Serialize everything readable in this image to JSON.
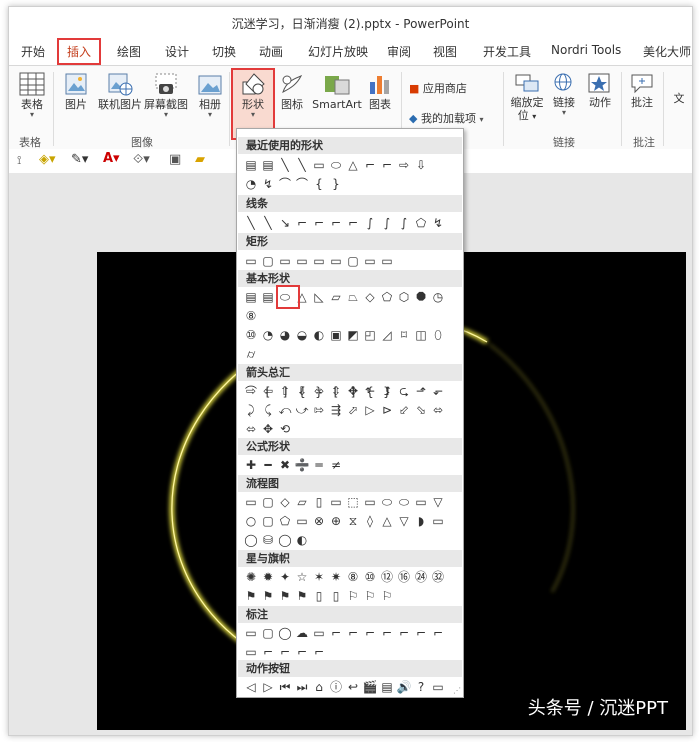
{
  "window": {
    "title": "沉迷学习，日渐消瘦 (2).pptx - PowerPoint"
  },
  "tabs": [
    {
      "label": "开始"
    },
    {
      "label": "插入",
      "active": true
    },
    {
      "label": "绘图"
    },
    {
      "label": "设计"
    },
    {
      "label": "切换"
    },
    {
      "label": "动画"
    },
    {
      "label": "幻灯片放映"
    },
    {
      "label": "审阅"
    },
    {
      "label": "视图"
    },
    {
      "label": "开发工具"
    },
    {
      "label": "Nordri Tools"
    },
    {
      "label": "美化大师"
    }
  ],
  "ribbon": {
    "table": "表格",
    "picture": "图片",
    "online_picture": "联机图片",
    "screenshot": "屏幕截图",
    "album": "相册",
    "shapes": "形状",
    "icons": "图标",
    "smartart": "SmartArt",
    "chart": "图表",
    "store": "应用商店",
    "my_addins": "我的加载项",
    "zoom_line1": "缩放定",
    "zoom_line2": "位",
    "link": "链接",
    "action": "动作",
    "comment": "批注",
    "text_partial": "文",
    "groups": {
      "table": "表格",
      "images": "图像",
      "links": "链接",
      "comments": "批注"
    }
  },
  "shapes_menu": {
    "sections": {
      "recent": "最近使用的形状",
      "lines": "线条",
      "rect": "矩形",
      "basic": "基本形状",
      "arrows": "箭头总汇",
      "equation": "公式形状",
      "flowchart": "流程图",
      "stars": "星与旗帜",
      "callouts": "标注",
      "action": "动作按钮"
    },
    "recent_row1": [
      "▤",
      "▤",
      "╲",
      "╲",
      "▭",
      "⬭",
      "△",
      "⌐",
      "⌐",
      "⇨",
      "⇩"
    ],
    "recent_row2": [
      "◔",
      "↯",
      "⌒",
      "⌒",
      "{",
      "}"
    ],
    "lines_row": [
      "╲",
      "╲",
      "↘",
      "⌐",
      "⌐",
      "⌐",
      "⌐",
      "∫",
      "∫",
      "∫",
      "⬠",
      "↯"
    ],
    "rect_row": [
      "▭",
      "▢",
      "▭",
      "▭",
      "▭",
      "▭",
      "▢",
      "▭",
      "▭"
    ],
    "basic_row1": [
      "▤",
      "▤",
      "⬭",
      "△",
      "◺",
      "▱",
      "⏢",
      "◇",
      "⬠",
      "⬡",
      "⯃",
      "◷",
      "⑧"
    ],
    "basic_row2": [
      "⑩",
      "◔",
      "◕",
      "◒",
      "◐",
      "▣",
      "◩",
      "◰",
      "◿",
      "⌑",
      "◫",
      "⬯",
      "⌭"
    ],
    "basic_row3": [
      "⬚",
      "▣",
      "◎",
      "⊘",
      "◠",
      "⎔",
      "☺",
      "♡",
      "⚡",
      "☼",
      "☾",
      "☁"
    ],
    "basic_row4": [
      "⌒",
      "[",
      "]",
      "{",
      "}",
      "[",
      "]",
      "{",
      "}"
    ],
    "arrows_row1": [
      "⇨",
      "⇦",
      "⇧",
      "⇩",
      "⬄",
      "⇳",
      "✥",
      "⬑",
      "⮥",
      "⮎",
      "⬏",
      "⬐"
    ],
    "arrows_row2": [
      "⤸",
      "⤹",
      "⤺",
      "⤻",
      "⇰",
      "⇶",
      "⬀",
      "▷",
      "⊳",
      "⬃",
      "⬂",
      "⬄"
    ],
    "arrows_row3": [
      "⬄",
      "✥",
      "⟲"
    ],
    "equation_row": [
      "✚",
      "━",
      "✖",
      "➗",
      "═",
      "≠"
    ],
    "flow_row1": [
      "▭",
      "▢",
      "◇",
      "▱",
      "▯",
      "▭",
      "⬚",
      "▭",
      "⬭",
      "⬭",
      "▭",
      "▽"
    ],
    "flow_row2": [
      "○",
      "▢",
      "⬠",
      "▭",
      "⊗",
      "⊕",
      "⧖",
      "◊",
      "△",
      "▽",
      "◗",
      "▭"
    ],
    "flow_row3": [
      "◯",
      "⛁",
      "◯",
      "◐"
    ],
    "stars_row1": [
      "✺",
      "✹",
      "✦",
      "☆",
      "✶",
      "✷",
      "⑧",
      "⑩",
      "⑫",
      "⑯",
      "㉔",
      "㉜"
    ],
    "stars_row2": [
      "⚑",
      "⚑",
      "⚑",
      "⚑",
      "▯",
      "▯",
      "⚐",
      "⚐",
      "⚐"
    ],
    "callouts_row1": [
      "▭",
      "▢",
      "◯",
      "☁",
      "▭",
      "⌐",
      "⌐",
      "⌐",
      "⌐",
      "⌐",
      "⌐",
      "⌐"
    ],
    "callouts_row2": [
      "▭",
      "⌐",
      "⌐",
      "⌐",
      "⌐"
    ],
    "action_row": [
      "◁",
      "▷",
      "⏮",
      "⏭",
      "⌂",
      "ⓘ",
      "↩",
      "🎬",
      "▤",
      "🔊",
      "?",
      "▭"
    ]
  },
  "watermark": "头条号 / 沉迷PPT"
}
